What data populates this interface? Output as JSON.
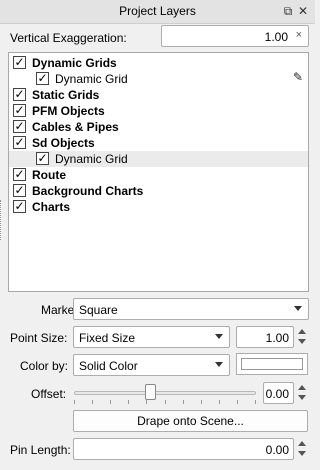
{
  "panel": {
    "title": "Project Layers",
    "float_icon": "⧉",
    "close_icon": "✕"
  },
  "vertical_exaggeration": {
    "label": "Vertical Exaggeration:",
    "value": "1.00",
    "clear_glyph": "×"
  },
  "layers": [
    {
      "label": "Dynamic Grids",
      "checked": true,
      "bold": true,
      "indent": 0
    },
    {
      "label": "Dynamic Grid",
      "checked": true,
      "bold": false,
      "indent": 1
    },
    {
      "label": "Static Grids",
      "checked": true,
      "bold": true,
      "indent": 0
    },
    {
      "label": "PFM Objects",
      "checked": true,
      "bold": true,
      "indent": 0
    },
    {
      "label": "Cables & Pipes",
      "checked": true,
      "bold": true,
      "indent": 0
    },
    {
      "label": "Sd Objects",
      "checked": true,
      "bold": true,
      "indent": 0
    },
    {
      "label": "Dynamic Grid",
      "checked": true,
      "bold": false,
      "indent": 1,
      "selected": true
    },
    {
      "label": "Route",
      "checked": true,
      "bold": true,
      "indent": 0
    },
    {
      "label": "Background Charts",
      "checked": true,
      "bold": true,
      "indent": 0
    },
    {
      "label": "Charts",
      "checked": true,
      "bold": true,
      "indent": 0
    }
  ],
  "check_glyph": "✓",
  "edit_icon_glyph": "✎",
  "marker": {
    "label": "Marker:",
    "value": "Square"
  },
  "point_size": {
    "label": "Point Size:",
    "mode": "Fixed Size",
    "value": "1.00"
  },
  "color_by": {
    "label": "Color by:",
    "mode": "Solid Color",
    "swatch_color": "#ffffff"
  },
  "offset": {
    "label": "Offset:",
    "slider_fraction": 0.42,
    "value": "0.00"
  },
  "drape_button": {
    "label": "Drape onto Scene..."
  },
  "pin_length": {
    "label": "Pin Length:",
    "value": "0.00"
  }
}
